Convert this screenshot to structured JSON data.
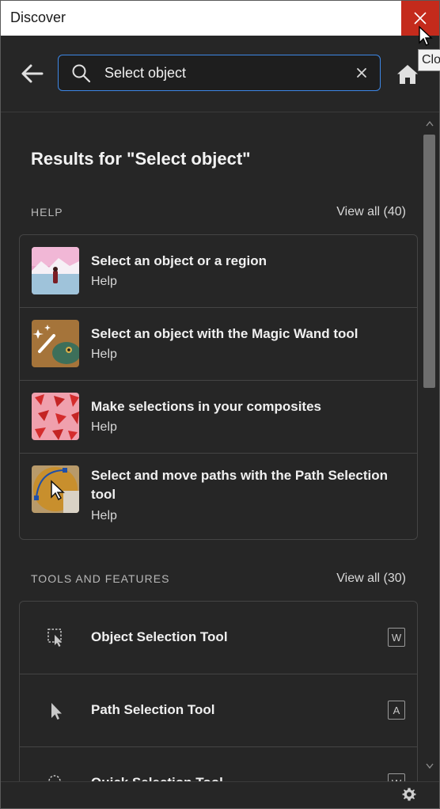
{
  "window": {
    "title": "Discover"
  },
  "tooltip": {
    "text": "Clo"
  },
  "search": {
    "value": "Select object"
  },
  "results": {
    "heading": "Results for \"Select object\""
  },
  "help": {
    "label": "HELP",
    "view_all": "View all (40)",
    "items": [
      {
        "title": "Select an object or a region",
        "subtitle": "Help"
      },
      {
        "title": "Select an object with the Magic Wand tool",
        "subtitle": "Help"
      },
      {
        "title": "Make selections in your composites",
        "subtitle": "Help"
      },
      {
        "title": "Select and move paths with the Path Selection tool",
        "subtitle": "Help"
      }
    ]
  },
  "tools": {
    "label": "TOOLS AND FEATURES",
    "view_all": "View all (30)",
    "items": [
      {
        "title": "Object Selection Tool",
        "shortcut": "W"
      },
      {
        "title": "Path Selection Tool",
        "shortcut": "A"
      },
      {
        "title": "Quick Selection Tool",
        "shortcut": "W"
      }
    ]
  }
}
